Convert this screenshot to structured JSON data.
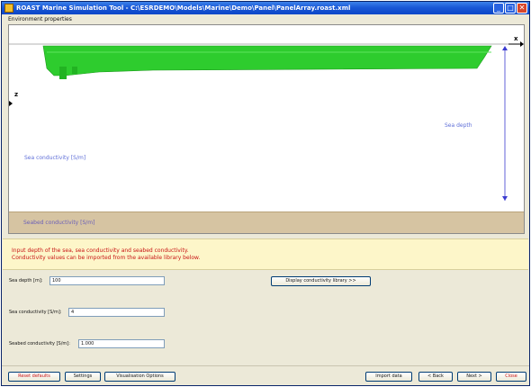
{
  "window": {
    "title": "ROAST Marine Simulation Tool - C:\\ESRDEMO\\Models\\Marine\\Demo\\Panel\\PanelArray.roast.xml",
    "minimize": "_",
    "maximize": "□",
    "close": "✕"
  },
  "section": {
    "label": "Environment properties"
  },
  "diagram": {
    "axis_x": "x",
    "axis_z": "z",
    "sea_depth_label": "Sea depth",
    "sea_conductivity_label": "Sea conductivity [S/m]",
    "seabed_conductivity_label": "Seabed conductivity [S/m]"
  },
  "instructions": {
    "line1": "Input depth of the sea, sea conductivity and seabed conductivity.",
    "line2": "Conductivity values can be imported from the available library below."
  },
  "form": {
    "sea_depth": {
      "label": "Sea depth [m]:",
      "value": "100"
    },
    "sea_conductivity": {
      "label": "Sea conductivity [S/m]:",
      "value": "4"
    },
    "seabed_conductivity": {
      "label": "Seabed conductivity [S/m]:",
      "value": "1.000"
    },
    "library_button": "Display conductivity library >>"
  },
  "buttons": {
    "reset": "Reset defaults",
    "settings": "Settings",
    "visualisation": "Visualisation Options",
    "import": "Import data",
    "back": "< Back",
    "next": "Next >",
    "cancel": "Close"
  },
  "colors": {
    "hull": "#2ecc2e",
    "seabed": "#d6c4a2",
    "instruction_text": "#c81414",
    "diagram_text": "#5f6fd8"
  }
}
